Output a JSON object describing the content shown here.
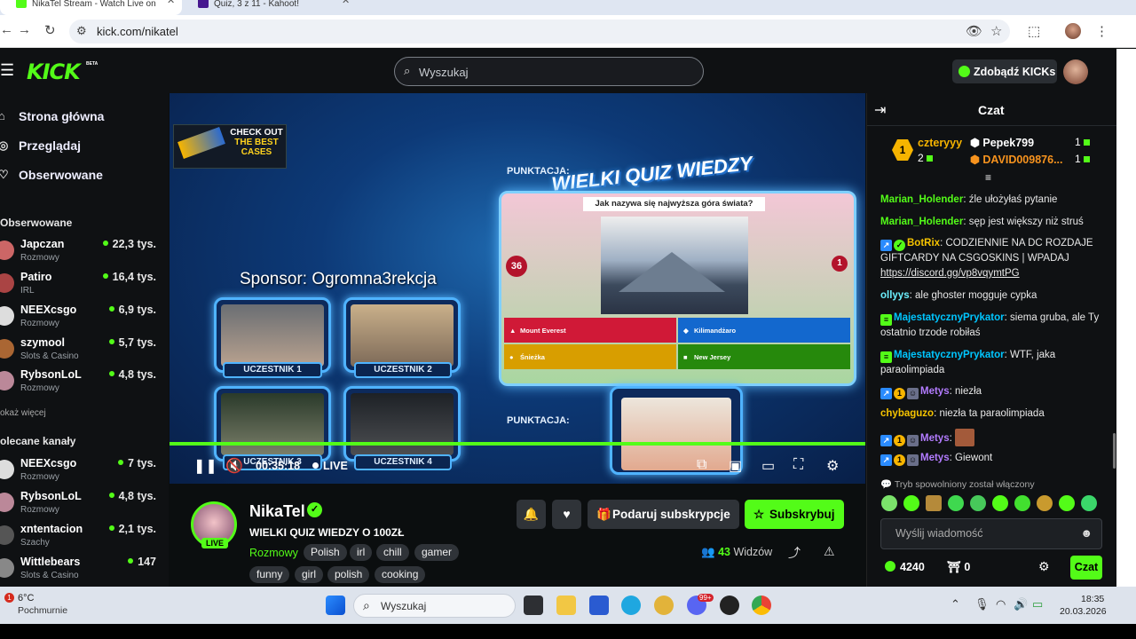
{
  "browser": {
    "tabs": [
      {
        "title": "NikaTel Stream - Watch Live on",
        "favicon_color": "#53fc18"
      },
      {
        "title": "Quiz, 3 z 11 - Kahoot!",
        "favicon_color": "#46178f"
      }
    ],
    "url": "kick.com/nikatel"
  },
  "header": {
    "logo": "KICK",
    "logo_badge": "BETA",
    "search_placeholder": "Wyszukaj",
    "get_kicks": "Zdobądź KICKs"
  },
  "sidebar": {
    "nav": [
      {
        "label": "Strona główna",
        "icon": "home-icon"
      },
      {
        "label": "Przeglądaj",
        "icon": "compass-icon"
      },
      {
        "label": "Obserwowane",
        "icon": "heart-icon"
      }
    ],
    "followed_heading": "Obserwowane",
    "followed": [
      {
        "name": "Japczan",
        "category": "Rozmowy",
        "viewers": "22,3 tys.",
        "avatar_color": "#c66"
      },
      {
        "name": "Patiro",
        "category": "IRL",
        "viewers": "16,4 tys.",
        "avatar_color": "#a44"
      },
      {
        "name": "NEEXcsgo",
        "category": "Rozmowy",
        "viewers": "6,9 tys.",
        "avatar_color": "#ddd"
      },
      {
        "name": "szymool",
        "category": "Slots & Casino",
        "viewers": "5,7 tys.",
        "avatar_color": "#a63"
      },
      {
        "name": "RybsonLoL",
        "category": "Rozmowy",
        "viewers": "4,8 tys.",
        "avatar_color": "#b89"
      }
    ],
    "show_more": "okaż więcej",
    "recommended_heading": "olecane kanały",
    "recommended": [
      {
        "name": "NEEXcsgo",
        "category": "Rozmowy",
        "viewers": "7 tys.",
        "avatar_color": "#ddd"
      },
      {
        "name": "RybsonLoL",
        "category": "Rozmowy",
        "viewers": "4,8 tys.",
        "avatar_color": "#b89"
      },
      {
        "name": "xntentacion",
        "category": "Szachy",
        "viewers": "2,1 tys.",
        "avatar_color": "#555"
      },
      {
        "name": "Wittlebears",
        "category": "Slots & Casino",
        "viewers": "147",
        "avatar_color": "#888"
      }
    ]
  },
  "video": {
    "ad_line1": "CHECK OUT",
    "ad_line2": "THE BEST",
    "ad_line3": "CASES",
    "quiz_title": "WIELKI QUIZ WIEDZY",
    "punktacja": "PUNKTACJA:",
    "sponsor": "Sponsor: Ogromna3rekcja",
    "question": "Jak nazywa się najwyższa góra świata?",
    "timer": "36",
    "answers_count": "1",
    "answers": [
      {
        "text": "Mount Everest",
        "color": "#d01937",
        "symbol": "▲"
      },
      {
        "text": "Kilimandżaro",
        "color": "#1368ce",
        "symbol": "◆"
      },
      {
        "text": "Śnieżka",
        "color": "#d89e00",
        "symbol": "●"
      },
      {
        "text": "New Jersey",
        "color": "#26890c",
        "symbol": "■"
      }
    ],
    "players": [
      "UCZESTNIK 1",
      "UCZESTNIK 2",
      "UCZESTNIK 3",
      "UCZESTNIK 4"
    ],
    "elapsed": "00:35:18",
    "live": "LIVE"
  },
  "stream": {
    "name": "NikaTel",
    "live_badge": "LIVE",
    "title": "WIELKI QUIZ WIEDZY O 100ZŁ",
    "category": "Rozmowy",
    "tags": [
      "Polish",
      "irl",
      "chill",
      "gamer",
      "funny",
      "girl",
      "polish",
      "cooking"
    ],
    "gift_label": "Podaruj subskrypcje",
    "subscribe_label": "Subskrybuj",
    "viewers_count": "43",
    "viewers_label": "Widzów"
  },
  "chat": {
    "title": "Czat",
    "top_gifters": [
      {
        "name": "czteryyy",
        "count": "2",
        "color": "#f6b400"
      },
      {
        "name": "Pepek799",
        "count": "1",
        "color": "#ffffff"
      },
      {
        "name": "DAVID009876...",
        "count": "1",
        "color": "#f7931e"
      }
    ],
    "gifter_rank": "1",
    "messages": [
      {
        "user": "Marian_Holender",
        "color": "#53fc18",
        "text": "źle ułożyłaś pytanie"
      },
      {
        "user": "Marian_Holender",
        "color": "#53fc18",
        "text": "sęp jest większy niż struś"
      },
      {
        "user": "BotRix",
        "color": "#f6c400",
        "text": "CODZIENNIE NA DC ROZDAJE GIFTCARDY NA CSGOSKINS | WPADAJ",
        "link": "https://discord.gg/vp8vqymtPG"
      },
      {
        "user": "ollyys",
        "color": "#6cf0ff",
        "text": "ale ghoster mogguje cypka"
      },
      {
        "user": "MajestatycznyPrykator",
        "color": "#00c6ff",
        "text": "siema gruba, ale Ty ostatnio trzode robiłaś"
      },
      {
        "user": "MajestatycznyPrykator",
        "color": "#00c6ff",
        "text": "WTF, jaka paraolimpiada"
      },
      {
        "user": "Metys",
        "color": "#b37cff",
        "text": "niezła"
      },
      {
        "user": "chybaguzo",
        "color": "#f6c400",
        "text": "niezła ta paraolimpiada"
      },
      {
        "user": "Metys",
        "color": "#b37cff",
        "text": ""
      },
      {
        "user": "Metys",
        "color": "#b37cff",
        "text": "Giewont"
      }
    ],
    "slow_mode": "Tryb spowolniony został włączony",
    "input_placeholder": "Wyślij wiadomość",
    "points": "4240",
    "streak": "0",
    "send_label": "Czat"
  },
  "taskbar": {
    "weather_temp": "6°C",
    "weather_desc": "Pochmurnie",
    "weather_badge": "1",
    "search_placeholder": "Wyszukaj",
    "time": "18:35",
    "date": "20.03.2026",
    "notification_badge": "99+"
  }
}
